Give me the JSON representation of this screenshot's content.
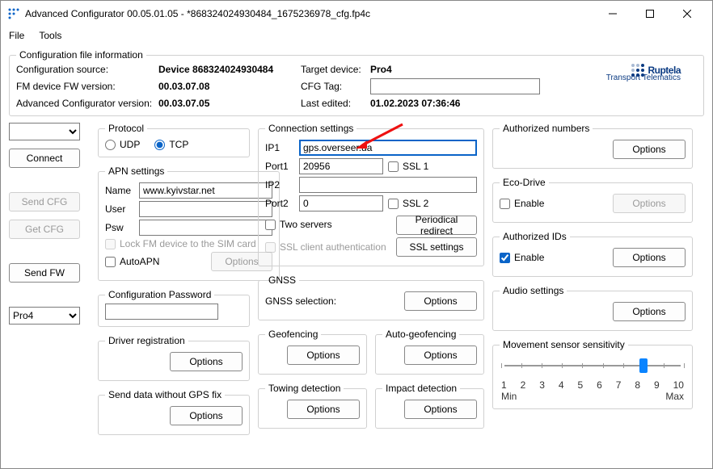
{
  "window": {
    "title": "Advanced Configurator 00.05.01.05 - *868324024930484_1675236978_cfg.fp4c"
  },
  "menu": {
    "file": "File",
    "tools": "Tools"
  },
  "fileInfo": {
    "legend": "Configuration file information",
    "src_lbl": "Configuration source:",
    "src_val": "Device 868324024930484",
    "fw_lbl": "FM device FW version:",
    "fw_val": "00.03.07.08",
    "cfg_lbl": "Advanced Configurator version:",
    "cfg_val": "00.03.07.05",
    "target_lbl": "Target device:",
    "target_val": "Pro4",
    "tag_lbl": "CFG Tag:",
    "tag_val": "",
    "edited_lbl": "Last edited:",
    "edited_val": "01.02.2023 07:36:46"
  },
  "logo": {
    "brand": "Ruptela",
    "tag": "Transport Telematics"
  },
  "sidebar": {
    "connect": "Connect",
    "send_cfg": "Send CFG",
    "get_cfg": "Get CFG",
    "send_fw": "Send FW",
    "device_sel": "Pro4"
  },
  "protocol": {
    "legend": "Protocol",
    "udp": "UDP",
    "tcp": "TCP"
  },
  "apn": {
    "legend": "APN settings",
    "name_lbl": "Name",
    "name_val": "www.kyivstar.net",
    "user_lbl": "User",
    "user_val": "",
    "psw_lbl": "Psw",
    "psw_val": "",
    "lock": "Lock FM device to the SIM card",
    "autoapn": "AutoAPN",
    "options": "Options"
  },
  "cfgpw": {
    "legend": "Configuration Password",
    "val": ""
  },
  "driverreg": {
    "legend": "Driver registration",
    "options": "Options"
  },
  "sendgps": {
    "legend": "Send data without GPS fix",
    "options": "Options"
  },
  "conn": {
    "legend": "Connection settings",
    "ip1_lbl": "IP1",
    "ip1_val": "gps.overseer.ua",
    "port1_lbl": "Port1",
    "port1_val": "20956",
    "ssl1": "SSL 1",
    "ip2_lbl": "IP2",
    "ip2_val": "",
    "port2_lbl": "Port2",
    "port2_val": "0",
    "ssl2": "SSL 2",
    "two": "Two servers",
    "periodical": "Periodical redirect",
    "sslauth": "SSL client authentication",
    "sslsettings": "SSL settings"
  },
  "gnss": {
    "legend": "GNSS",
    "sel_lbl": "GNSS selection:",
    "options": "Options"
  },
  "geo": {
    "legend": "Geofencing",
    "options": "Options"
  },
  "autogeo": {
    "legend": "Auto-geofencing",
    "options": "Options"
  },
  "towing": {
    "legend": "Towing detection",
    "options": "Options"
  },
  "impact": {
    "legend": "Impact detection",
    "options": "Options"
  },
  "authnum": {
    "legend": "Authorized numbers",
    "options": "Options"
  },
  "eco": {
    "legend": "Eco-Drive",
    "enable": "Enable",
    "options": "Options"
  },
  "authids": {
    "legend": "Authorized IDs",
    "enable": "Enable",
    "options": "Options"
  },
  "audio": {
    "legend": "Audio settings",
    "options": "Options"
  },
  "mss": {
    "legend": "Movement sensor sensitivity",
    "ticks": [
      "1",
      "2",
      "3",
      "4",
      "5",
      "6",
      "7",
      "8",
      "9",
      "10"
    ],
    "min": "Min",
    "max": "Max",
    "value": 8
  }
}
